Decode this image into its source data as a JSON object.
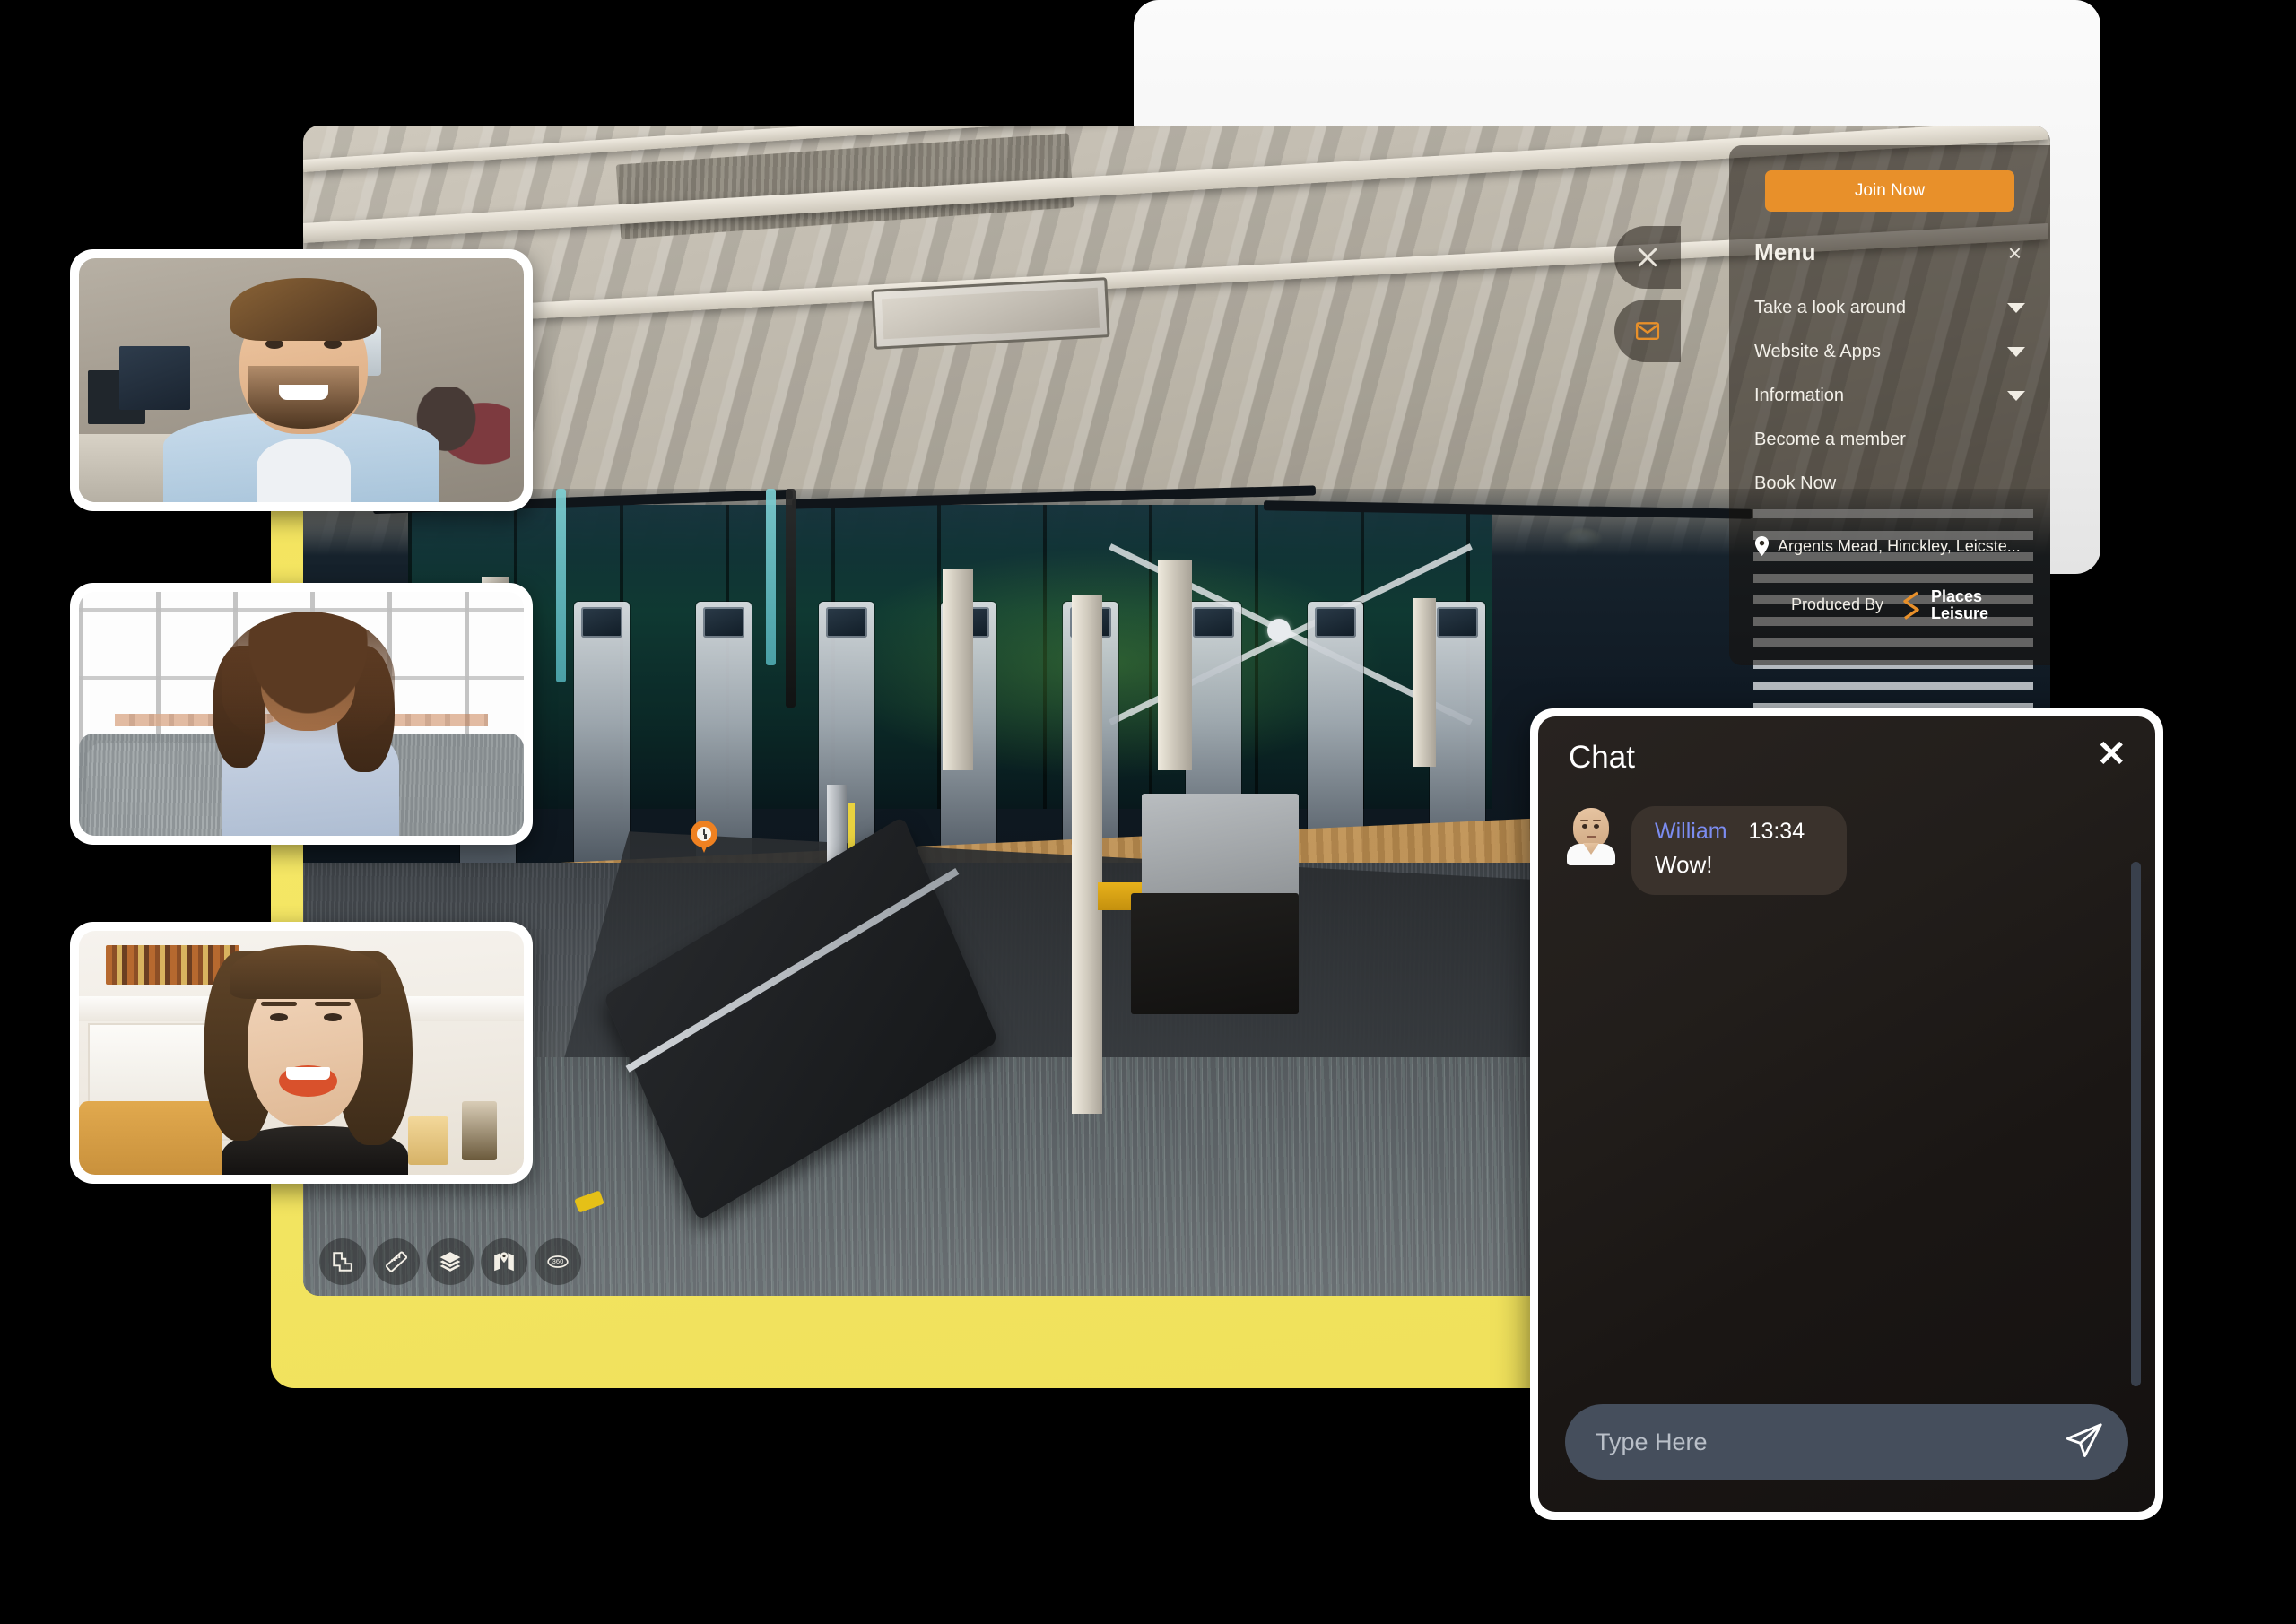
{
  "viewer": {
    "hotspot_icon": "clock-pin-icon",
    "toolbar": [
      {
        "name": "floorplan",
        "icon": "floorplan-icon"
      },
      {
        "name": "measure",
        "icon": "ruler-icon"
      },
      {
        "name": "layers",
        "icon": "layers-icon"
      },
      {
        "name": "map",
        "icon": "map-icon"
      },
      {
        "name": "three-sixty",
        "icon": "360-icon",
        "label": "360"
      }
    ]
  },
  "menu": {
    "join_now_label": "Join Now",
    "title": "Menu",
    "close_label": "×",
    "items": [
      {
        "label": "Take a look around",
        "has_caret": true
      },
      {
        "label": "Website & Apps",
        "has_caret": true
      },
      {
        "label": "Information",
        "has_caret": true
      },
      {
        "label": "Become a member",
        "has_caret": false
      },
      {
        "label": "Book Now",
        "has_caret": false
      }
    ],
    "address": "Argents Mead, Hinckley, Leicste...",
    "address_icon": "location-pin-icon",
    "produced_by_label": "Produced By",
    "brand_line1": "Places",
    "brand_line2": "Leisure",
    "accent_color": "#e8902a"
  },
  "side_tabs": [
    {
      "name": "close-tab",
      "icon": "close-icon",
      "label": "×"
    },
    {
      "name": "mail-tab",
      "icon": "envelope-icon"
    }
  ],
  "chat": {
    "title": "Chat",
    "close_label": "✕",
    "messages": [
      {
        "sender": "William",
        "time": "13:34",
        "text": "Wow!",
        "avatar": "avatar-william",
        "sender_color": "#7b8cf0"
      }
    ],
    "input_placeholder": "Type Here",
    "input_value": "",
    "send_icon": "send-paper-plane-icon"
  },
  "thumbnails": [
    {
      "name": "participant-1",
      "alt": "man-in-office-video"
    },
    {
      "name": "participant-2",
      "alt": "woman-on-sofa-video"
    },
    {
      "name": "participant-3",
      "alt": "woman-laughing-video"
    }
  ],
  "theme": {
    "accent_yellow": "#f2e25c",
    "accent_orange": "#e8902a",
    "chat_bg": "#1a1614",
    "input_bg": "#454e5c"
  }
}
